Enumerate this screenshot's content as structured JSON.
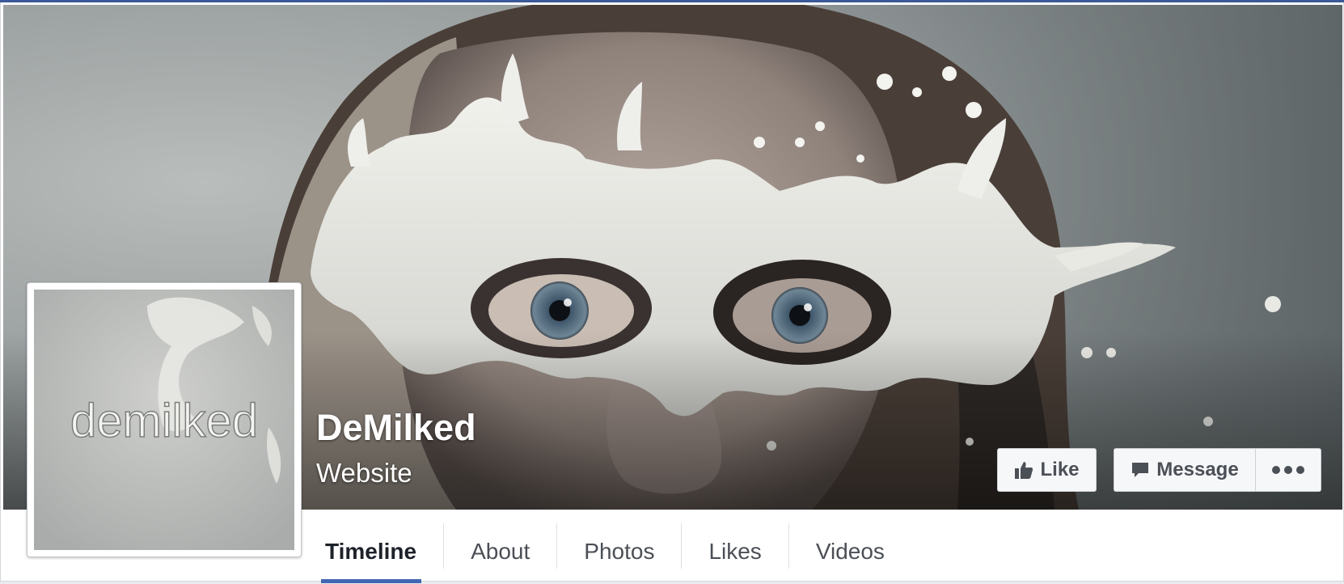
{
  "page": {
    "name": "DeMilked",
    "category": "Website"
  },
  "profile_picture": {
    "logo_text": "demilked"
  },
  "actions": {
    "like_label": "Like",
    "message_label": "Message"
  },
  "tabs": [
    {
      "label": "Timeline",
      "active": true
    },
    {
      "label": "About",
      "active": false
    },
    {
      "label": "Photos",
      "active": false
    },
    {
      "label": "Likes",
      "active": false
    },
    {
      "label": "Videos",
      "active": false
    }
  ],
  "icons": {
    "like": "thumbs-up-icon",
    "message": "speech-bubble-icon",
    "more": "more-dots-icon"
  },
  "colors": {
    "brand": "#3b5998",
    "tab_underline": "#4267b2",
    "button_bg": "#f6f7f9",
    "button_text": "#4b4f56"
  }
}
